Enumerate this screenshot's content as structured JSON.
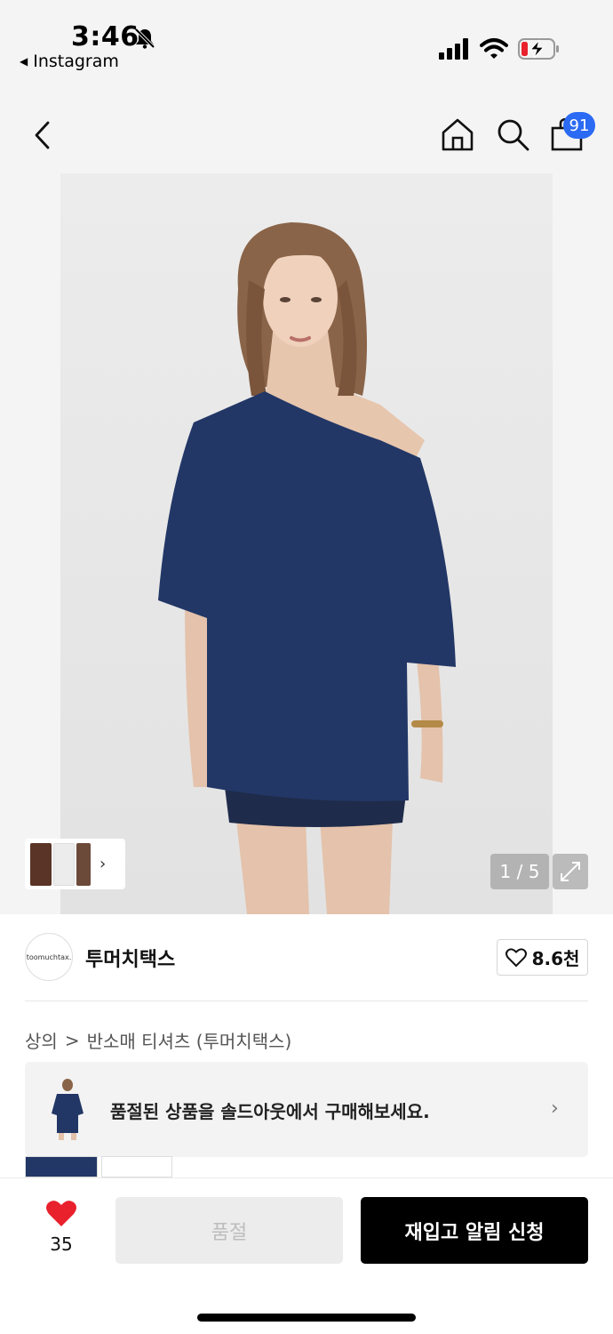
{
  "status_bar": {
    "time": "3:46",
    "back_app": "Instagram"
  },
  "header": {
    "cart_count": "91"
  },
  "gallery": {
    "counter": "1 / 5",
    "thumb_colors": [
      "#5a3426",
      "#ececec",
      "#6b4a3a"
    ]
  },
  "brand": {
    "logo_text": "toomuchtax.",
    "name": "투머치택스",
    "like_count": "8.6천"
  },
  "breadcrumb": {
    "category": "상의",
    "separator": ">",
    "subcategory": "반소매 티셔츠 (투머치택스)"
  },
  "banner": {
    "text": "품절된 상품을 솔드아웃에서 구매해보세요."
  },
  "bottom_bar": {
    "wish_count": "35",
    "soldout_label": "품절",
    "restock_label": "재입고 알림 신청"
  },
  "colors": {
    "accent_badge": "#2b6af3",
    "heart": "#e8212d",
    "primary_button": "#000000",
    "shirt": "#223766"
  }
}
